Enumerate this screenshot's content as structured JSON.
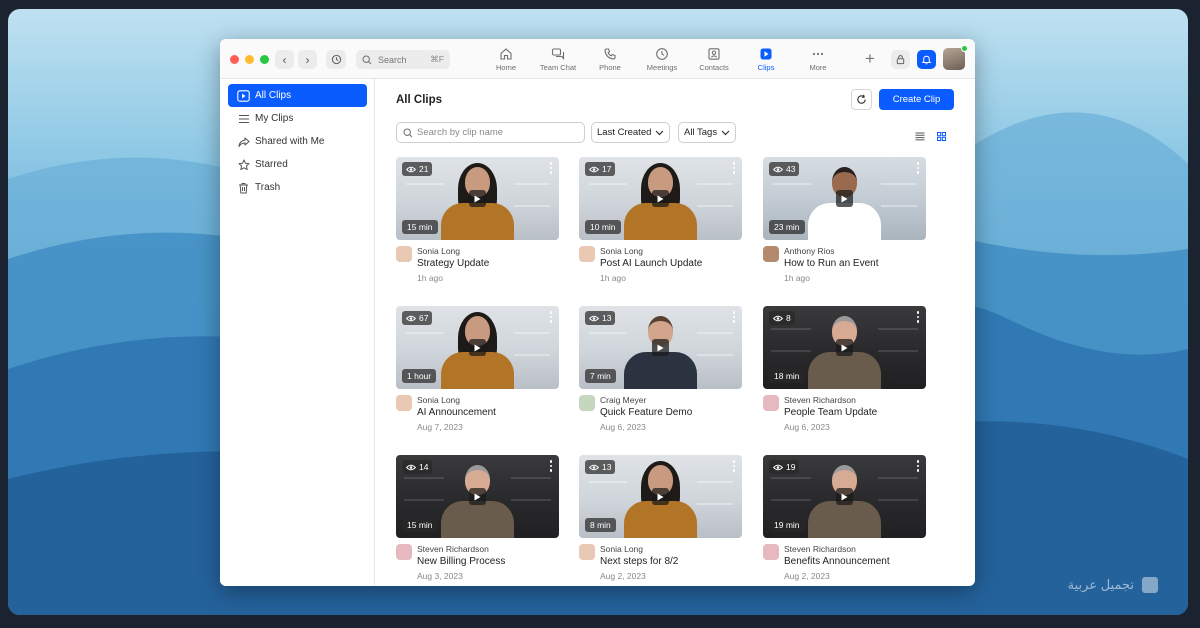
{
  "colors": {
    "accent": "#0b5cff",
    "backdrop_top": "#bfe1f1",
    "backdrop_bottom": "#2a6aa6"
  },
  "watermark": {
    "text": "تجميل عربية",
    "icon": "logo-icon"
  },
  "titlebar": {
    "search": {
      "label": "Search",
      "shortcut": "⌘F"
    },
    "tabs": [
      {
        "label": "Home",
        "icon": "home-icon"
      },
      {
        "label": "Team Chat",
        "icon": "chat-icon"
      },
      {
        "label": "Phone",
        "icon": "phone-icon"
      },
      {
        "label": "Meetings",
        "icon": "clock-icon"
      },
      {
        "label": "Contacts",
        "icon": "contacts-icon"
      },
      {
        "label": "Clips",
        "icon": "clips-icon",
        "active": true
      },
      {
        "label": "More",
        "icon": "more-icon"
      }
    ],
    "plus": "+"
  },
  "sidebar": {
    "items": [
      {
        "label": "All Clips",
        "icon": "clips-icon",
        "active": true
      },
      {
        "label": "My Clips",
        "icon": "list-icon"
      },
      {
        "label": "Shared with Me",
        "icon": "share-icon"
      },
      {
        "label": "Starred",
        "icon": "star-icon"
      },
      {
        "label": "Trash",
        "icon": "trash-icon"
      }
    ]
  },
  "main": {
    "title": "All Clips",
    "create_label": "Create Clip",
    "search_placeholder": "Search by clip name",
    "sort_label": "Last Created",
    "tags_label": "All Tags",
    "clips": [
      {
        "views": "21",
        "duration": "15 min",
        "owner": "Sonia Long",
        "title": "Strategy Update",
        "date": "1h ago",
        "scene": "light",
        "person": "woman"
      },
      {
        "views": "17",
        "duration": "10 min",
        "owner": "Sonia Long",
        "title": "Post AI Launch Update",
        "date": "1h ago",
        "scene": "light",
        "person": "woman"
      },
      {
        "views": "43",
        "duration": "23 min",
        "owner": "Anthony Rios",
        "title": "How to Run an Event",
        "date": "1h ago",
        "scene": "office",
        "person": "man-headset"
      },
      {
        "views": "67",
        "duration": "1 hour",
        "owner": "Sonia Long",
        "title": "AI Announcement",
        "date": "Aug 7, 2023",
        "scene": "light",
        "person": "woman"
      },
      {
        "views": "13",
        "duration": "7 min",
        "owner": "Craig Meyer",
        "title": "Quick Feature Demo",
        "date": "Aug 6, 2023",
        "scene": "light",
        "person": "man-suit"
      },
      {
        "views": "8",
        "duration": "18 min",
        "owner": "Steven Richardson",
        "title": "People Team Update",
        "date": "Aug 6, 2023",
        "scene": "dark",
        "person": "man-grey"
      },
      {
        "views": "14",
        "duration": "15 min",
        "owner": "Steven Richardson",
        "title": "New Billing Process",
        "date": "Aug 3, 2023",
        "scene": "dark",
        "person": "man-grey"
      },
      {
        "views": "13",
        "duration": "8 min",
        "owner": "Sonia Long",
        "title": "Next steps for 8/2",
        "date": "Aug 2, 2023",
        "scene": "light",
        "person": "woman"
      },
      {
        "views": "19",
        "duration": "19 min",
        "owner": "Steven Richardson",
        "title": "Benefits Announcement",
        "date": "Aug 2, 2023",
        "scene": "dark",
        "person": "man-grey"
      }
    ]
  }
}
